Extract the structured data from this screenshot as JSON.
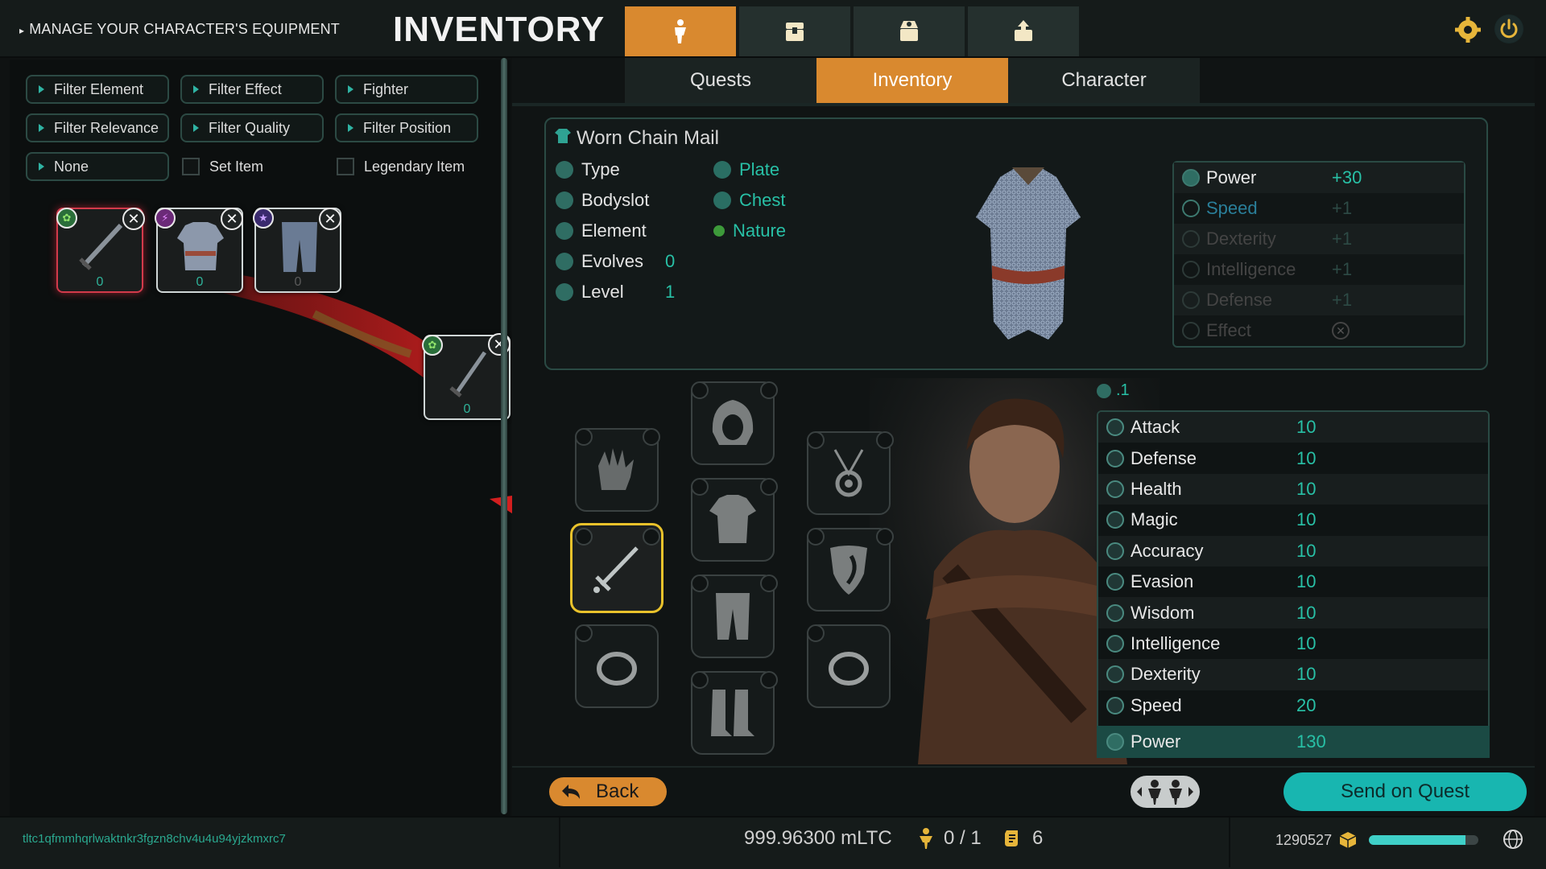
{
  "header": {
    "subtitle": "MANAGE YOUR CHARACTER'S EQUIPMENT",
    "title": "INVENTORY",
    "tabs": [
      "character-icon",
      "chest-icon-1",
      "chest-icon-2",
      "chest-icon-3"
    ],
    "active_tab": 0
  },
  "filters": {
    "row1": [
      "Filter Element",
      "Filter Effect",
      "Fighter"
    ],
    "row2": [
      "Filter Relevance",
      "Filter Quality",
      "Filter Position"
    ],
    "none": "None",
    "set_item": "Set Item",
    "legendary_item": "Legendary Item"
  },
  "inventory_slots": [
    {
      "icon": "sword-icon",
      "count": "0",
      "badge": "nature-icon",
      "selected": true
    },
    {
      "icon": "chainmail-icon",
      "count": "0",
      "badge": "magic-icon",
      "selected": false
    },
    {
      "icon": "leggings-icon",
      "count": "0",
      "badge": "pentagram-icon",
      "selected": false
    }
  ],
  "dragged_item": {
    "icon": "sword-icon",
    "count": "0"
  },
  "subtabs": [
    "Quests",
    "Inventory",
    "Character"
  ],
  "active_subtab": 1,
  "item": {
    "name": "Worn Chain Mail",
    "rows": [
      {
        "label": "Type",
        "value": "Plate"
      },
      {
        "label": "Bodyslot",
        "value": "Chest"
      },
      {
        "label": "Element",
        "value": "Nature"
      },
      {
        "label": "Evolves",
        "value": "0"
      },
      {
        "label": "Level",
        "value": "1"
      }
    ],
    "stats": [
      {
        "name": "Power",
        "value": "+30",
        "dim": false
      },
      {
        "name": "Speed",
        "value": "+1",
        "dim": true
      },
      {
        "name": "Dexterity",
        "value": "+1",
        "dim": true
      },
      {
        "name": "Intelligence",
        "value": "+1",
        "dim": true
      },
      {
        "name": "Defense",
        "value": "+1",
        "dim": true
      },
      {
        "name": "Effect",
        "value": "✕",
        "dim": true
      }
    ]
  },
  "character": {
    "level": ".1",
    "stats": [
      {
        "name": "Attack",
        "value": "10"
      },
      {
        "name": "Defense",
        "value": "10"
      },
      {
        "name": "Health",
        "value": "10"
      },
      {
        "name": "Magic",
        "value": "10"
      },
      {
        "name": "Accuracy",
        "value": "10"
      },
      {
        "name": "Evasion",
        "value": "10"
      },
      {
        "name": "Wisdom",
        "value": "10"
      },
      {
        "name": "Intelligence",
        "value": "10"
      },
      {
        "name": "Dexterity",
        "value": "10"
      },
      {
        "name": "Speed",
        "value": "20"
      }
    ],
    "power_label": "Power",
    "power_value": "130"
  },
  "actions": {
    "back": "Back",
    "send": "Send on Quest"
  },
  "footer": {
    "address": "tltc1qfmmhqrlwaktnkr3fgzn8chv4u4u94yjzkmxrc7",
    "balance": "999.96300 mLTC",
    "party": "0 / 1",
    "quests": "6",
    "block": "1290527",
    "sync_progress": 0.88
  },
  "colors": {
    "accent_orange": "#d9892f",
    "accent_teal": "#28c0a6",
    "send_button": "#18b6b0"
  }
}
